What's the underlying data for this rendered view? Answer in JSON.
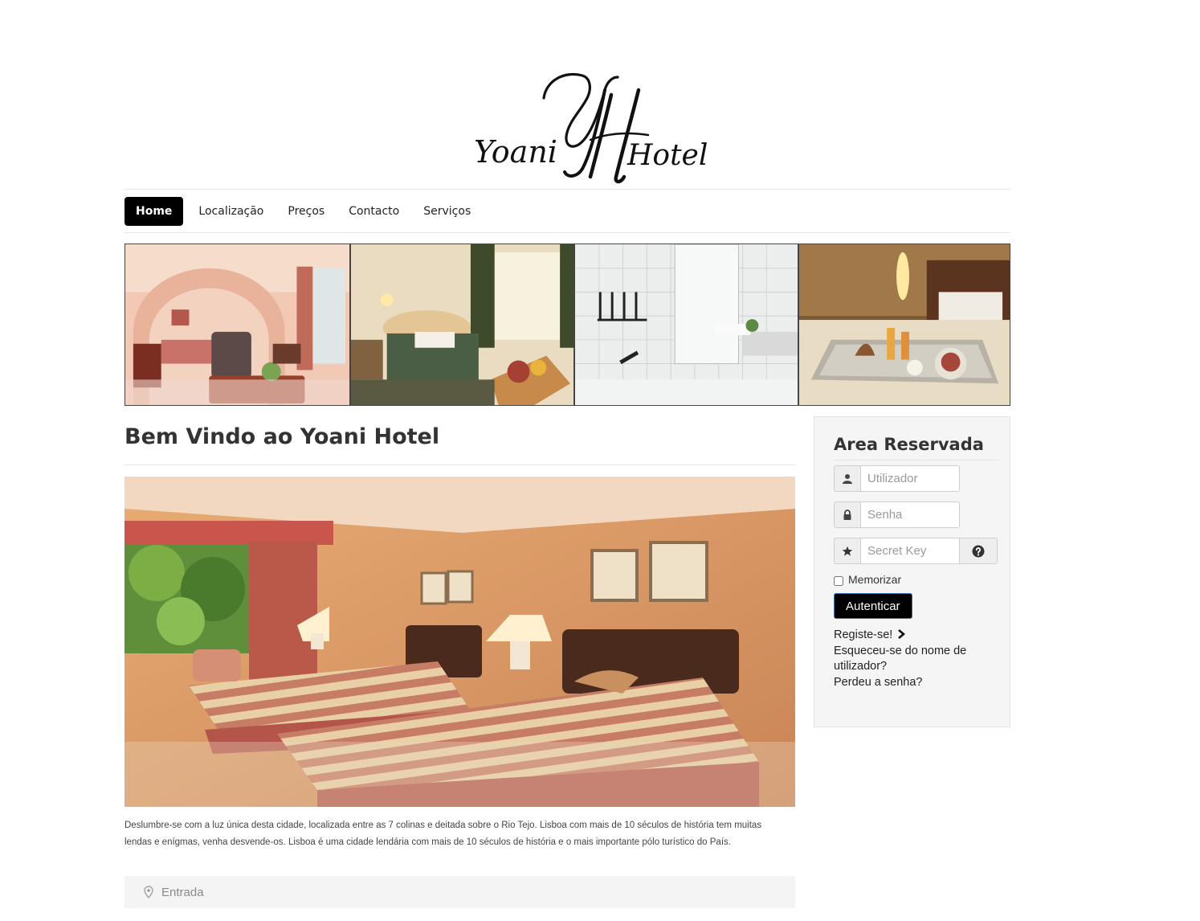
{
  "logo": {
    "initials": "YH",
    "word_left": "Yoani",
    "word_right": "Hotel"
  },
  "nav": {
    "items": [
      {
        "label": "Home",
        "active": true
      },
      {
        "label": "Localização"
      },
      {
        "label": "Preços"
      },
      {
        "label": "Contacto"
      },
      {
        "label": "Serviços"
      }
    ]
  },
  "banner": {
    "photos": [
      "suite-sitting-room",
      "bedroom-with-fruit",
      "bathroom",
      "breakfast-tray"
    ]
  },
  "main": {
    "title": "Bem Vindo ao Yoani Hotel",
    "photo": "twin-bed-room",
    "description": "Deslumbre-se com a luz única desta cidade, localizada entre as 7 colinas e deitada sobre o Rio Tejo. Lisboa com mais de 10 séculos de história tem muitas lendas e enígmas, venha desvende-os. Lisboa é uma cidade lendária com mais de 10 séculos de história e o mais importante pólo turístico do País.",
    "location_label": "Entrada"
  },
  "sidebar": {
    "title": "Area Reservada",
    "username_placeholder": "Utilizador",
    "password_placeholder": "Senha",
    "secretkey_placeholder": "Secret Key",
    "remember_label": "Memorizar",
    "login_button": "Autenticar",
    "register_link": "Registe-se!",
    "forgot_username_link": "Esqueceu-se do nome de utilizador?",
    "forgot_password_link": "Perdeu a senha?"
  },
  "colors": {
    "nav_active_bg": "#000000",
    "button_bg": "#000000",
    "sidebar_bg": "#f5f5f5"
  }
}
